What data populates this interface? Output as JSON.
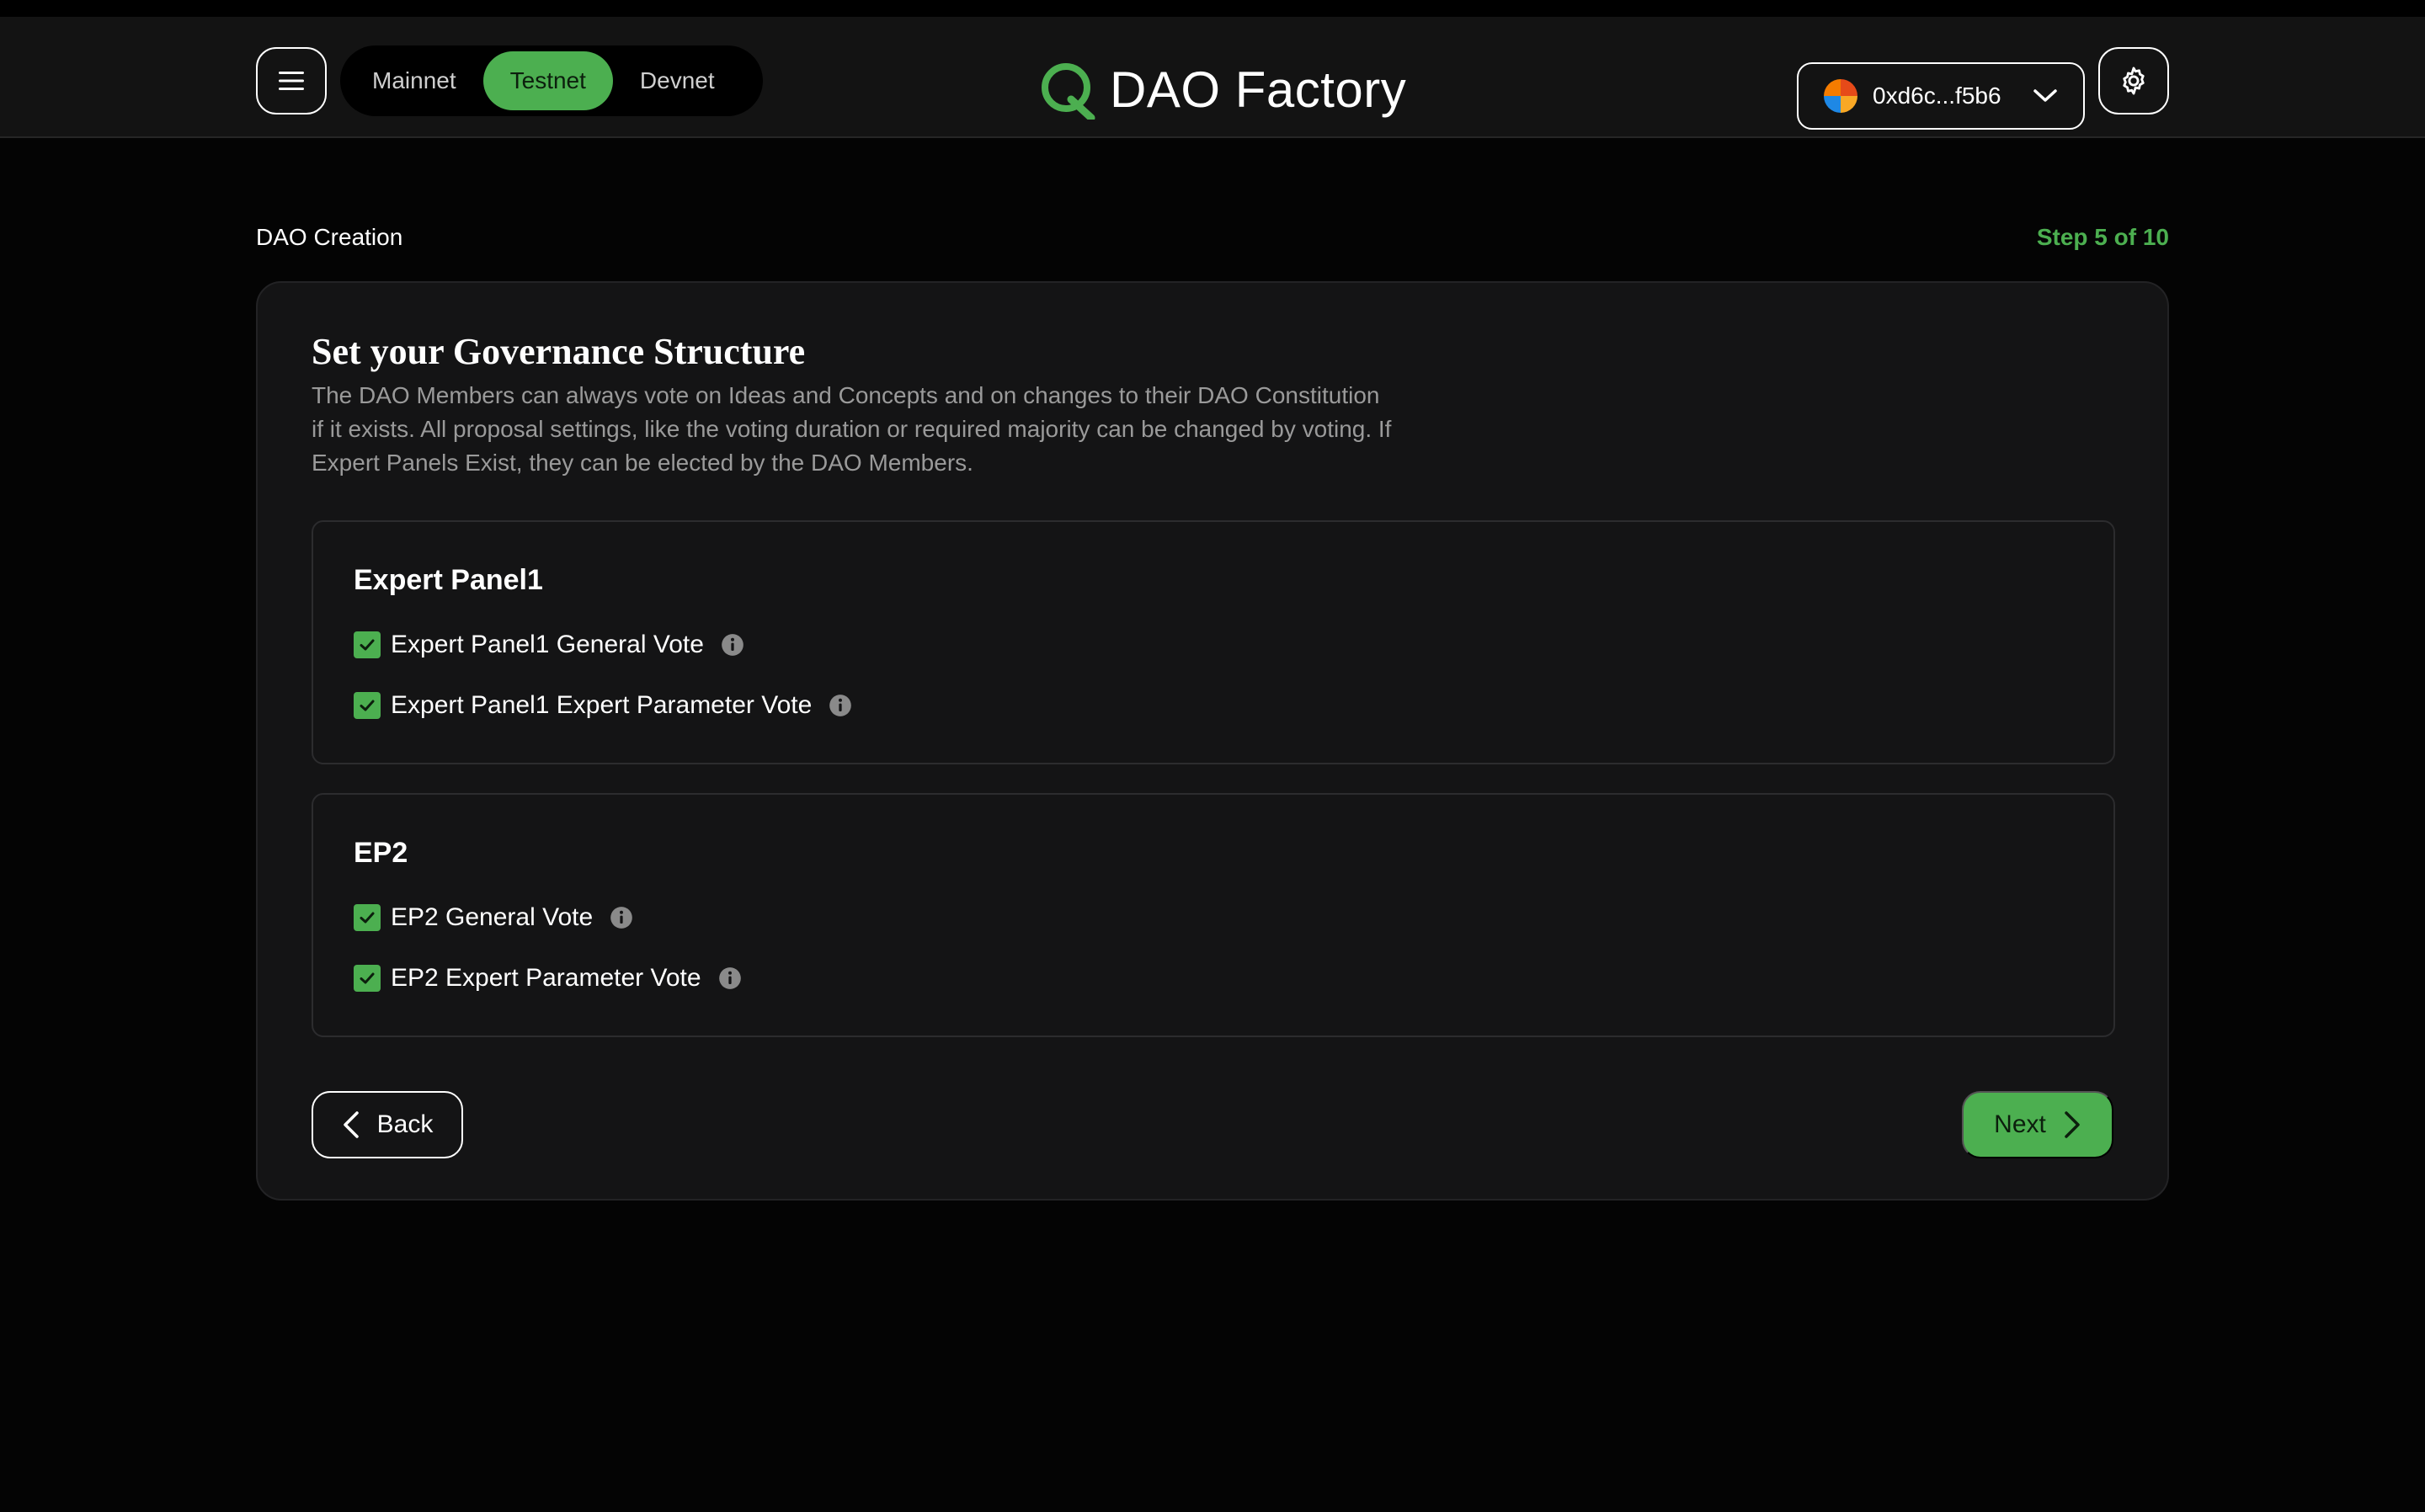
{
  "header": {
    "networks": [
      {
        "label": "Mainnet",
        "active": false
      },
      {
        "label": "Testnet",
        "active": true
      },
      {
        "label": "Devnet",
        "active": false
      }
    ],
    "brand": "DAO Factory",
    "wallet_address": "0xd6c...f5b6"
  },
  "breadcrumb": "DAO Creation",
  "step": "Step 5 of 10",
  "card": {
    "title": "Set your Governance Structure",
    "description": "The DAO Members can always vote on Ideas and Concepts and on changes to their DAO Constitution if it exists. All proposal settings, like the voting duration or required majority can be changed by voting. If Expert Panels Exist, they can be elected by the DAO Members."
  },
  "panels": [
    {
      "title": "Expert Panel1",
      "options": [
        {
          "label": "Expert Panel1 General Vote",
          "checked": true
        },
        {
          "label": "Expert Panel1 Expert Parameter Vote",
          "checked": true
        }
      ]
    },
    {
      "title": "EP2",
      "options": [
        {
          "label": "EP2 General Vote",
          "checked": true
        },
        {
          "label": "EP2 Expert Parameter Vote",
          "checked": true
        }
      ]
    }
  ],
  "actions": {
    "back_label": "Back",
    "next_label": "Next"
  },
  "colors": {
    "accent": "#4caf50",
    "background": "#040404",
    "card": "#141415",
    "muted_text": "#9a9a9a"
  }
}
